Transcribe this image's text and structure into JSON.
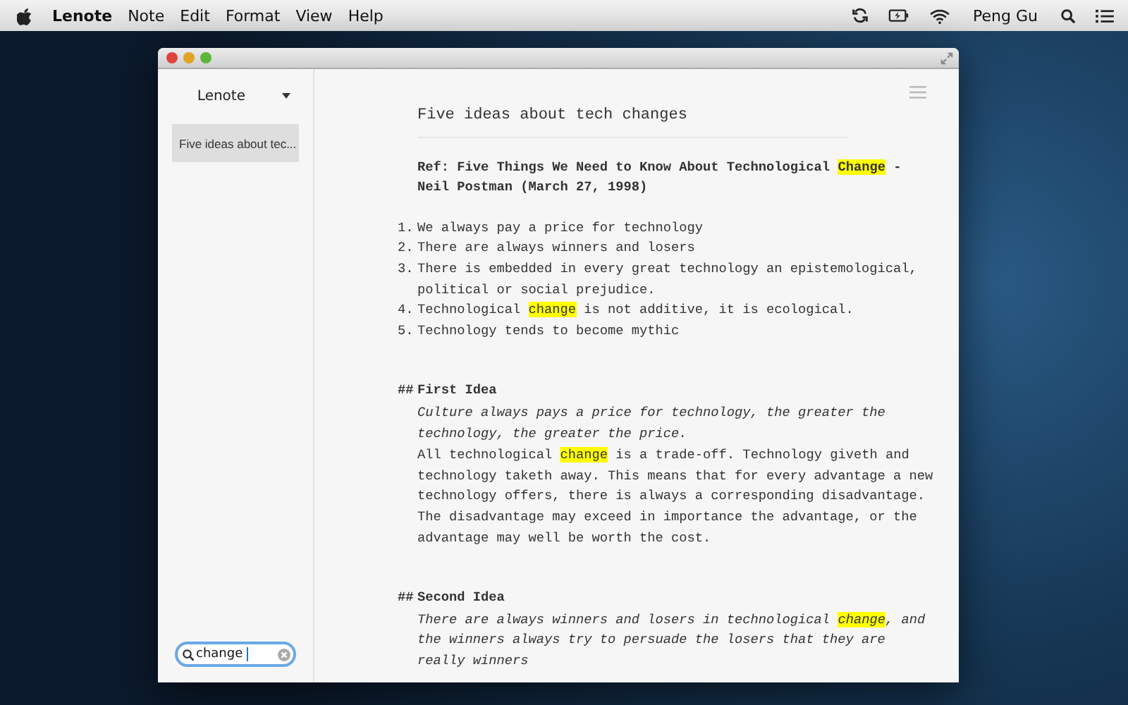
{
  "menubar": {
    "app": "Lenote",
    "menus": [
      "Note",
      "Edit",
      "Format",
      "View",
      "Help"
    ],
    "user": "Peng Gu"
  },
  "sidebar": {
    "notebook": "Lenote",
    "notes": [
      {
        "title": "Five ideas about tec...",
        "selected": true
      }
    ],
    "search": {
      "value": "change"
    }
  },
  "editor": {
    "title": "Five ideas about tech changes",
    "blocks": [
      {
        "kind": "ref",
        "segments": [
          {
            "text": "Ref: Five Things We Need to Know About Technological ",
            "highlight": false
          },
          {
            "text": "Change",
            "highlight": true
          },
          {
            "text": " - Neil Postman (March 27, 1998)",
            "highlight": false
          }
        ]
      },
      {
        "kind": "list",
        "items": [
          {
            "number": "1.",
            "segments": [
              {
                "text": "We always pay a price for technology",
                "highlight": false
              }
            ]
          },
          {
            "number": "2.",
            "segments": [
              {
                "text": "There are always winners and losers",
                "highlight": false
              }
            ]
          },
          {
            "number": "3.",
            "segments": [
              {
                "text": "There is embedded in every great technology an epistemological, political or social prejudice.",
                "highlight": false
              }
            ]
          },
          {
            "number": "4.",
            "segments": [
              {
                "text": "Technological ",
                "highlight": false
              },
              {
                "text": "change",
                "highlight": true
              },
              {
                "text": " is not additive, it is ecological.",
                "highlight": false
              }
            ]
          },
          {
            "number": "5.",
            "segments": [
              {
                "text": "Technology tends to become mythic",
                "highlight": false
              }
            ]
          }
        ]
      },
      {
        "kind": "heading",
        "marker": "##",
        "text": "First Idea"
      },
      {
        "kind": "quote",
        "segments": [
          {
            "text": "Culture always pays a price for technology, the greater the technology, the greater the price.",
            "highlight": false
          }
        ]
      },
      {
        "kind": "para",
        "segments": [
          {
            "text": "All technological ",
            "highlight": false
          },
          {
            "text": "change",
            "highlight": true
          },
          {
            "text": " is a trade-off. Technology giveth and technology taketh away. This means that for every advantage a new technology offers, there is always a corresponding disadvantage. The disadvantage may exceed in importance the advantage, or the advantage may well be worth the cost.",
            "highlight": false
          }
        ]
      },
      {
        "kind": "heading",
        "marker": "##",
        "text": "Second Idea"
      },
      {
        "kind": "quote",
        "segments": [
          {
            "text": "There are always winners and losers in technological ",
            "highlight": false
          },
          {
            "text": "change",
            "highlight": true
          },
          {
            "text": ", and the winners always try to persuade the losers that they are really winners",
            "highlight": false
          }
        ]
      }
    ]
  }
}
